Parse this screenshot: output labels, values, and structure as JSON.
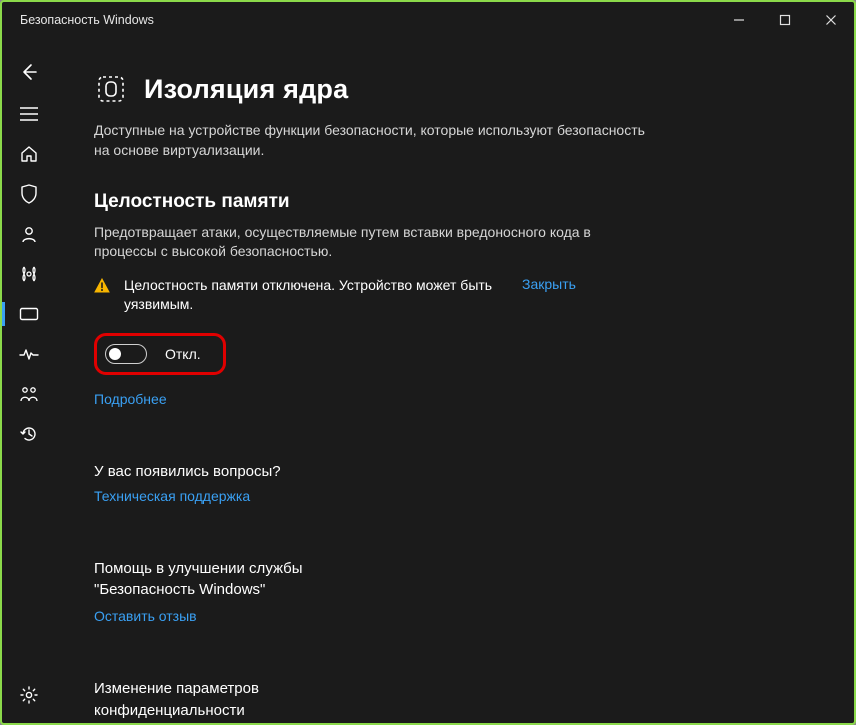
{
  "window": {
    "title": "Безопасность Windows"
  },
  "page": {
    "title": "Изоляция ядра",
    "description": "Доступные на устройстве функции безопасности, которые используют безопасность на основе виртуализации."
  },
  "memory_integrity": {
    "title": "Целостность памяти",
    "description": "Предотвращает атаки, осуществляемые путем вставки вредоносного кода в процессы с высокой безопасностью.",
    "warning": "Целостность памяти отключена. Устройство может быть уязвимым.",
    "dismiss": "Закрыть",
    "toggle_state": "off",
    "toggle_label": "Откл.",
    "learn_more": "Подробнее"
  },
  "questions": {
    "title": "У вас появились вопросы?",
    "link": "Техническая поддержка"
  },
  "feedback": {
    "title": "Помощь в улучшении службы \"Безопасность Windows\"",
    "link": "Оставить отзыв"
  },
  "privacy": {
    "title": "Изменение параметров конфиденциальности"
  },
  "colors": {
    "link": "#3aa0f3",
    "highlight_border": "#e00000",
    "frame_outline": "#8bd94a",
    "background": "#1b1b1b",
    "warning": "#f7b500"
  }
}
